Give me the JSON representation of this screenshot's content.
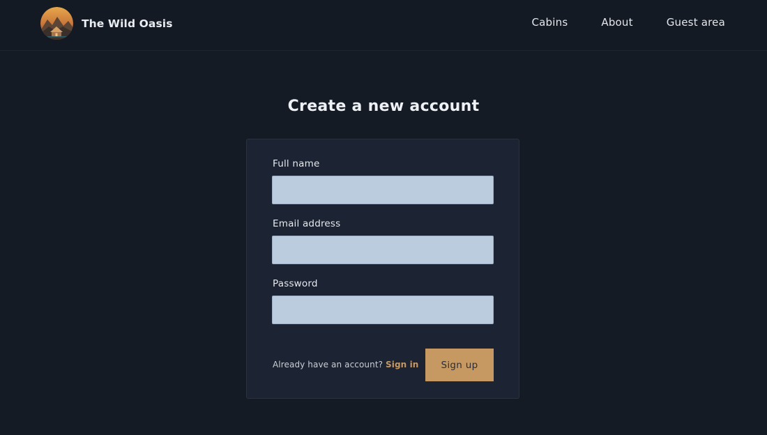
{
  "brand": {
    "name": "The Wild Oasis",
    "logo_icon": "cabin-mountain-logo-icon"
  },
  "nav": {
    "items": [
      {
        "label": "Cabins"
      },
      {
        "label": "About"
      },
      {
        "label": "Guest area"
      }
    ]
  },
  "page": {
    "title": "Create a new account"
  },
  "form": {
    "full_name_label": "Full name",
    "full_name_value": "",
    "email_label": "Email address",
    "email_value": "",
    "password_label": "Password",
    "password_value": "",
    "have_account_text": "Already have an account?",
    "sign_in_link": "Sign in",
    "submit_label": "Sign up"
  },
  "colors": {
    "background": "#151b25",
    "card": "#1c2333",
    "input": "#bcccdf",
    "accent": "#c69963",
    "text": "#e6e9ee"
  }
}
